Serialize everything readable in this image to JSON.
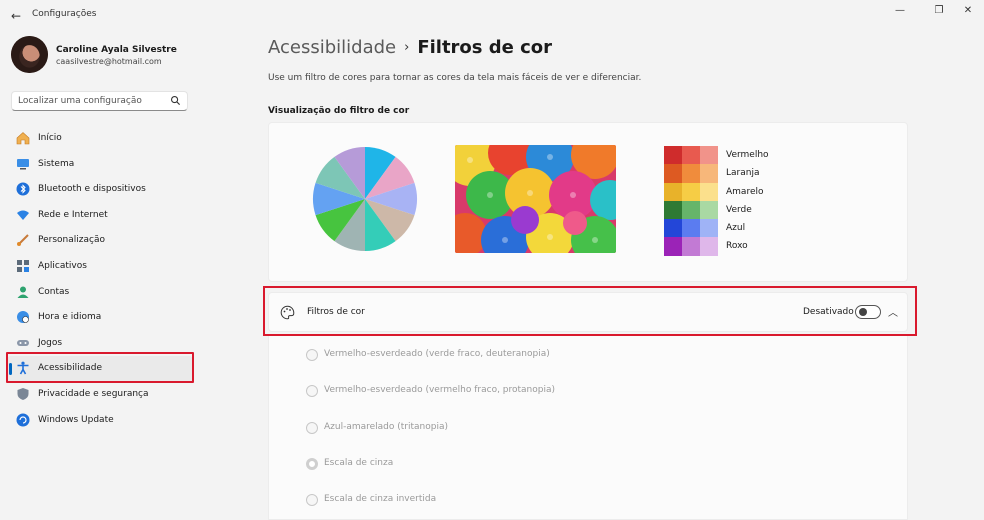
{
  "window": {
    "title": "Configurações",
    "minimize": "—",
    "maximize": "❐",
    "close": "✕",
    "back": "←"
  },
  "profile": {
    "name": "Caroline Ayala Silvestre",
    "email": "caasilvestre@hotmail.com"
  },
  "search": {
    "placeholder": "Localizar uma configuração"
  },
  "nav": {
    "items": [
      {
        "label": "Início",
        "icon": "home-icon"
      },
      {
        "label": "Sistema",
        "icon": "system-icon"
      },
      {
        "label": "Bluetooth e dispositivos",
        "icon": "bluetooth-icon"
      },
      {
        "label": "Rede e Internet",
        "icon": "wifi-icon"
      },
      {
        "label": "Personalização",
        "icon": "brush-icon"
      },
      {
        "label": "Aplicativos",
        "icon": "apps-icon"
      },
      {
        "label": "Contas",
        "icon": "account-icon"
      },
      {
        "label": "Hora e idioma",
        "icon": "globe-clock-icon"
      },
      {
        "label": "Jogos",
        "icon": "gamepad-icon"
      },
      {
        "label": "Acessibilidade",
        "icon": "accessibility-icon",
        "active": true
      },
      {
        "label": "Privacidade e segurança",
        "icon": "shield-icon"
      },
      {
        "label": "Windows Update",
        "icon": "update-icon"
      }
    ]
  },
  "main": {
    "breadcrumb_parent": "Acessibilidade",
    "breadcrumb_sep": "›",
    "breadcrumb_current": "Filtros de cor",
    "description": "Use um filtro de cores para tornar as cores da tela mais fáceis de ver e diferenciar.",
    "preview_title": "Visualização do filtro de cor",
    "swatch_labels": [
      "Vermelho",
      "Laranja",
      "Amarelo",
      "Verde",
      "Azul",
      "Roxo"
    ],
    "filter": {
      "label": "Filtros de cor",
      "state": "Desativado",
      "enabled": false
    },
    "options": [
      {
        "label": "Vermelho-esverdeado (verde fraco, deuteranopia)",
        "selected": false
      },
      {
        "label": "Vermelho-esverdeado (vermelho fraco, protanopia)",
        "selected": false
      },
      {
        "label": "Azul-amarelado (tritanopia)",
        "selected": false
      },
      {
        "label": "Escala de cinza",
        "selected": true
      },
      {
        "label": "Escala de cinza invertida",
        "selected": false
      }
    ]
  },
  "colors": {
    "accent": "#0067c0",
    "highlight": "#d9192d",
    "swatches": [
      [
        "#cf2c2c",
        "#e85a4f",
        "#f1938a"
      ],
      [
        "#dd5a22",
        "#f08c3c",
        "#f7b77a"
      ],
      [
        "#e8b22a",
        "#f6cd45",
        "#fbe08c"
      ],
      [
        "#2e7a34",
        "#66b56a",
        "#a9d9a3"
      ],
      [
        "#2346d8",
        "#5b7cf0",
        "#9fb3f6"
      ],
      [
        "#9b23b7",
        "#c27ad4",
        "#dfb7ea"
      ]
    ],
    "pie": [
      "#1fb5e8",
      "#e9a5c7",
      "#a8b3f4",
      "#cdb8a8",
      "#34cdb8",
      "#9fb4b3",
      "#47c43f",
      "#64a2f2",
      "#7dc6b6",
      "#b69bd8"
    ]
  }
}
